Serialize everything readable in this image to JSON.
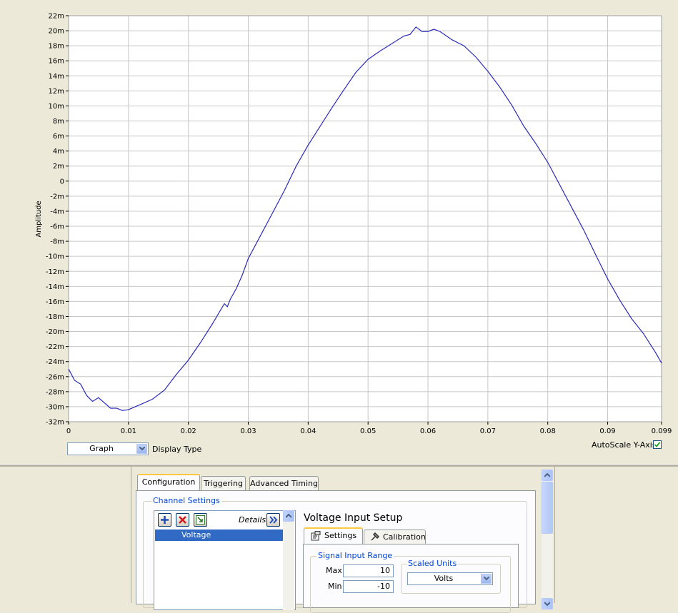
{
  "graph": {
    "y_axis_title": "Amplitude",
    "display_type_label": "Display Type",
    "display_type_value": "Graph",
    "autoscale_label": "AutoScale Y-Axis",
    "autoscale_checked": true,
    "plot_color": "#2A2AB8"
  },
  "chart_data": {
    "type": "line",
    "title": "",
    "xlabel": "",
    "ylabel": "Amplitude",
    "xlim": [
      0,
      0.099
    ],
    "ylim": [
      -32,
      22
    ],
    "x_ticks": [
      "0",
      "0.01",
      "0.02",
      "0.03",
      "0.04",
      "0.05",
      "0.06",
      "0.07",
      "0.08",
      "0.09",
      "0.099"
    ],
    "y_ticks": [
      "22m",
      "20m",
      "18m",
      "16m",
      "14m",
      "12m",
      "10m",
      "8m",
      "6m",
      "4m",
      "2m",
      "0",
      "-2m",
      "-4m",
      "-6m",
      "-8m",
      "-10m",
      "-12m",
      "-14m",
      "-16m",
      "-18m",
      "-20m",
      "-22m",
      "-24m",
      "-26m",
      "-28m",
      "-30m",
      "-32m"
    ],
    "grid": true,
    "series": [
      {
        "x": [
          0,
          0.001,
          0.002,
          0.003,
          0.004,
          0.005,
          0.006,
          0.007,
          0.008,
          0.009,
          0.01,
          0.012,
          0.014,
          0.016,
          0.018,
          0.02,
          0.022,
          0.024,
          0.026,
          0.0265,
          0.027,
          0.028,
          0.029,
          0.03,
          0.032,
          0.034,
          0.036,
          0.038,
          0.04,
          0.042,
          0.044,
          0.046,
          0.048,
          0.05,
          0.052,
          0.054,
          0.056,
          0.057,
          0.058,
          0.059,
          0.06,
          0.061,
          0.062,
          0.064,
          0.066,
          0.068,
          0.07,
          0.072,
          0.074,
          0.076,
          0.078,
          0.08,
          0.082,
          0.084,
          0.086,
          0.088,
          0.09,
          0.092,
          0.094,
          0.096,
          0.098,
          0.099
        ],
        "y": [
          -25,
          -26.5,
          -27,
          -28.5,
          -29.3,
          -28.8,
          -29.5,
          -30.2,
          -30.2,
          -30.5,
          -30.4,
          -29.7,
          -29,
          -27.8,
          -25.7,
          -23.8,
          -21.5,
          -19,
          -16.3,
          -16.7,
          -15.7,
          -14.3,
          -12.5,
          -10.3,
          -7.3,
          -4.3,
          -1.3,
          2,
          4.8,
          7.3,
          9.8,
          12.2,
          14.5,
          16.2,
          17.3,
          18.3,
          19.3,
          19.5,
          20.5,
          19.9,
          19.9,
          20.2,
          19.9,
          18.8,
          18,
          16.5,
          14.6,
          12.5,
          10.1,
          7.3,
          5,
          2.5,
          -0.5,
          -3.5,
          -6.5,
          -9.8,
          -13,
          -15.8,
          -18.3,
          -20.3,
          -22.8,
          -24.2
        ]
      }
    ]
  },
  "config": {
    "tabs": [
      {
        "label": "Configuration"
      },
      {
        "label": "Triggering"
      },
      {
        "label": "Advanced Timing"
      }
    ],
    "channel_settings_title": "Channel Settings",
    "details_label": "Details",
    "channels": [
      "Voltage"
    ],
    "setup_title": "Voltage Input Setup",
    "subtabs": [
      {
        "label": "Settings"
      },
      {
        "label": "Calibration"
      }
    ],
    "signal_input_range_title": "Signal Input Range",
    "max_label": "Max",
    "max_value": "10",
    "min_label": "Min",
    "min_value": "-10",
    "scaled_units_title": "Scaled Units",
    "scaled_units_value": "Volts"
  }
}
